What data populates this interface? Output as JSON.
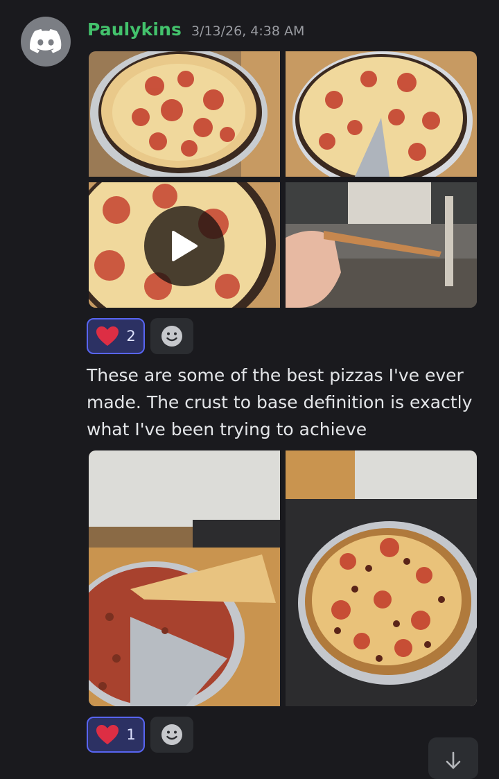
{
  "message": {
    "username": "Paulykins",
    "timestamp": "3/13/26, 4:38 AM",
    "avatar_icon": "discord-logo-icon",
    "text": "These are some of the best pizzas I've ever made. The crust to base definition is exactly what I've been trying to achieve"
  },
  "attachments_group_1": {
    "items": [
      {
        "kind": "image",
        "description_icon": "pizza-photo"
      },
      {
        "kind": "image",
        "description_icon": "pizza-slice-removed-photo"
      },
      {
        "kind": "video",
        "description_icon": "pizza-closeup-video",
        "overlay_icon": "play-icon"
      },
      {
        "kind": "image",
        "description_icon": "hand-holding-crust-photo"
      }
    ]
  },
  "reactions_1": {
    "emoji": "❤️",
    "count": "2",
    "add_icon": "add-reaction-smiley-icon"
  },
  "attachments_group_2": {
    "items": [
      {
        "kind": "image",
        "description_icon": "slice-lift-photo"
      },
      {
        "kind": "image",
        "description_icon": "pepperoni-sausage-pizza-photo"
      }
    ]
  },
  "reactions_2": {
    "emoji": "❤️",
    "count": "1",
    "add_icon": "add-reaction-smiley-icon"
  },
  "colors": {
    "background": "#1a1a1e",
    "username": "#43c26c",
    "reaction_active_bg": "#2c3163",
    "reaction_active_border": "#5865f2"
  },
  "scroll_icon": "arrow-down-icon"
}
